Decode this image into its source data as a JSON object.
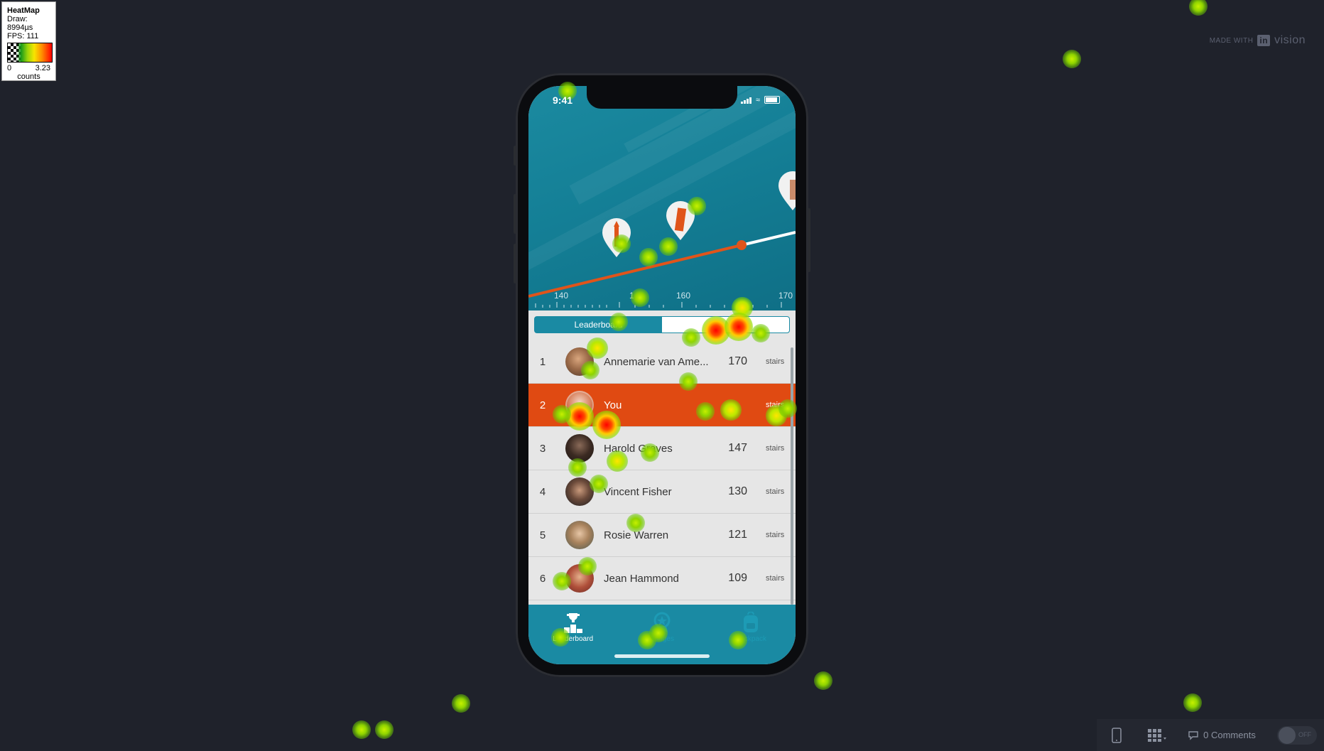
{
  "heatmap_legend": {
    "title": "HeatMap",
    "draw": "Draw: 8994µs",
    "fps": "FPS: 111",
    "min": "0",
    "max": "3.23",
    "unit": "counts"
  },
  "branding": {
    "made_with": "MADE WITH",
    "logo_in": "in",
    "logo_rest": "vision"
  },
  "phone": {
    "status_time": "9:41",
    "axis_labels": [
      "140",
      "1",
      "160",
      "170"
    ],
    "segment_active": "Leaderboard",
    "leaderboard": [
      {
        "rank": "1",
        "name": "Annemarie van Ame...",
        "score": "170",
        "unit": "stairs",
        "highlight": false
      },
      {
        "rank": "2",
        "name": "You",
        "score": "",
        "unit": "stairs",
        "highlight": true
      },
      {
        "rank": "3",
        "name": "Harold Graves",
        "score": "147",
        "unit": "stairs",
        "highlight": false
      },
      {
        "rank": "4",
        "name": "Vincent Fisher",
        "score": "130",
        "unit": "stairs",
        "highlight": false
      },
      {
        "rank": "5",
        "name": "Rosie Warren",
        "score": "121",
        "unit": "stairs",
        "highlight": false
      },
      {
        "rank": "6",
        "name": "Jean Hammond",
        "score": "109",
        "unit": "stairs",
        "highlight": false
      }
    ],
    "tabs": [
      {
        "label": "Leaderboard",
        "icon": "trophy-podium-icon",
        "active": true
      },
      {
        "label": "Badges",
        "icon": "badge-icon",
        "active": false
      },
      {
        "label": "Backpack",
        "icon": "backpack-icon",
        "active": false
      }
    ]
  },
  "toolbar": {
    "comments": "0 Comments",
    "toggle": "OFF"
  },
  "colors": {
    "background": "#1f222b",
    "accent_teal": "#1a8aa3",
    "highlight_orange": "#e04a12"
  }
}
